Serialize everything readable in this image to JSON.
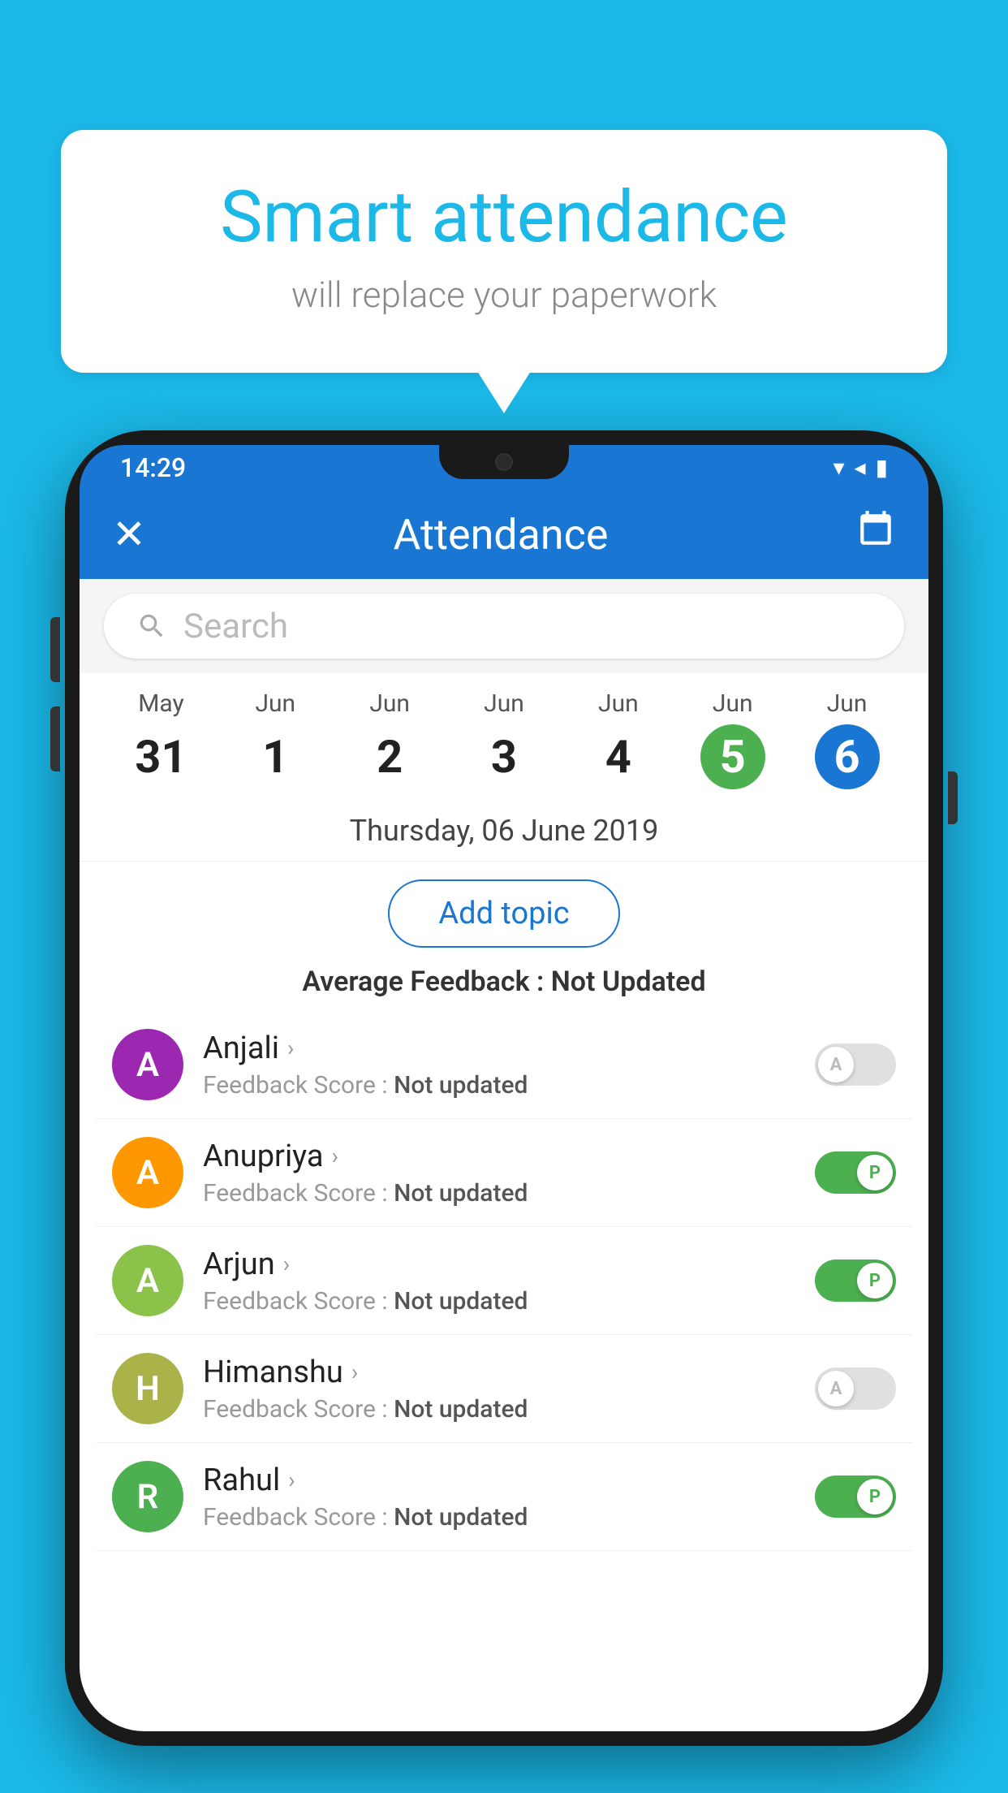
{
  "background_color": "#1bb8e8",
  "bubble": {
    "title": "Smart attendance",
    "subtitle": "will replace your paperwork"
  },
  "status_bar": {
    "time": "14:29",
    "wifi_icon": "▼",
    "signal_icon": "◀",
    "battery_icon": "▮"
  },
  "app_bar": {
    "title": "Attendance",
    "close_label": "✕",
    "calendar_label": "📅"
  },
  "search": {
    "placeholder": "Search"
  },
  "dates": [
    {
      "month": "May",
      "day": "31",
      "active": false,
      "color": null
    },
    {
      "month": "Jun",
      "day": "1",
      "active": false,
      "color": null
    },
    {
      "month": "Jun",
      "day": "2",
      "active": false,
      "color": null
    },
    {
      "month": "Jun",
      "day": "3",
      "active": false,
      "color": null
    },
    {
      "month": "Jun",
      "day": "4",
      "active": false,
      "color": null
    },
    {
      "month": "Jun",
      "day": "5",
      "active": true,
      "color": "green"
    },
    {
      "month": "Jun",
      "day": "6",
      "active": true,
      "color": "blue"
    }
  ],
  "selected_date_label": "Thursday, 06 June 2019",
  "add_topic_label": "Add topic",
  "feedback_avg_label": "Average Feedback : ",
  "feedback_avg_value": "Not Updated",
  "students": [
    {
      "name": "Anjali",
      "avatar_letter": "A",
      "avatar_color": "#9c27b0",
      "feedback_label": "Feedback Score : ",
      "feedback_value": "Not updated",
      "toggle": "off"
    },
    {
      "name": "Anupriya",
      "avatar_letter": "A",
      "avatar_color": "#ff9800",
      "feedback_label": "Feedback Score : ",
      "feedback_value": "Not updated",
      "toggle": "on"
    },
    {
      "name": "Arjun",
      "avatar_letter": "A",
      "avatar_color": "#8bc34a",
      "feedback_label": "Feedback Score : ",
      "feedback_value": "Not updated",
      "toggle": "on"
    },
    {
      "name": "Himanshu",
      "avatar_letter": "H",
      "avatar_color": "#aab34a",
      "feedback_label": "Feedback Score : ",
      "feedback_value": "Not updated",
      "toggle": "off"
    },
    {
      "name": "Rahul",
      "avatar_letter": "R",
      "avatar_color": "#4caf50",
      "feedback_label": "Feedback Score : ",
      "feedback_value": "Not updated",
      "toggle": "on"
    }
  ]
}
